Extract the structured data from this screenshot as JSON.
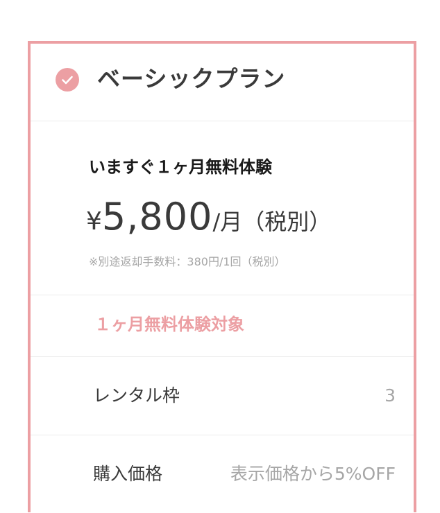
{
  "colors": {
    "accent": "#ec9fa3",
    "text_primary": "#3a3a3a",
    "text_muted": "#a6a6a6",
    "divider": "#ececec"
  },
  "plan": {
    "name": "ベーシックプラン",
    "selected": true,
    "selected_icon": "check-circle-icon"
  },
  "pricing": {
    "promo_title": "いますぐ１ヶ月無料体験",
    "currency_symbol": "¥",
    "amount": "5,800",
    "unit": "/月（税別）",
    "fee_note": "※別途返却手数料：380円/1回（税別）"
  },
  "trial": {
    "label": "１ヶ月無料体験対象"
  },
  "specs": [
    {
      "label": "レンタル枠",
      "value": "3"
    },
    {
      "label": "購入価格",
      "value": "表示価格から5%OFF"
    }
  ]
}
